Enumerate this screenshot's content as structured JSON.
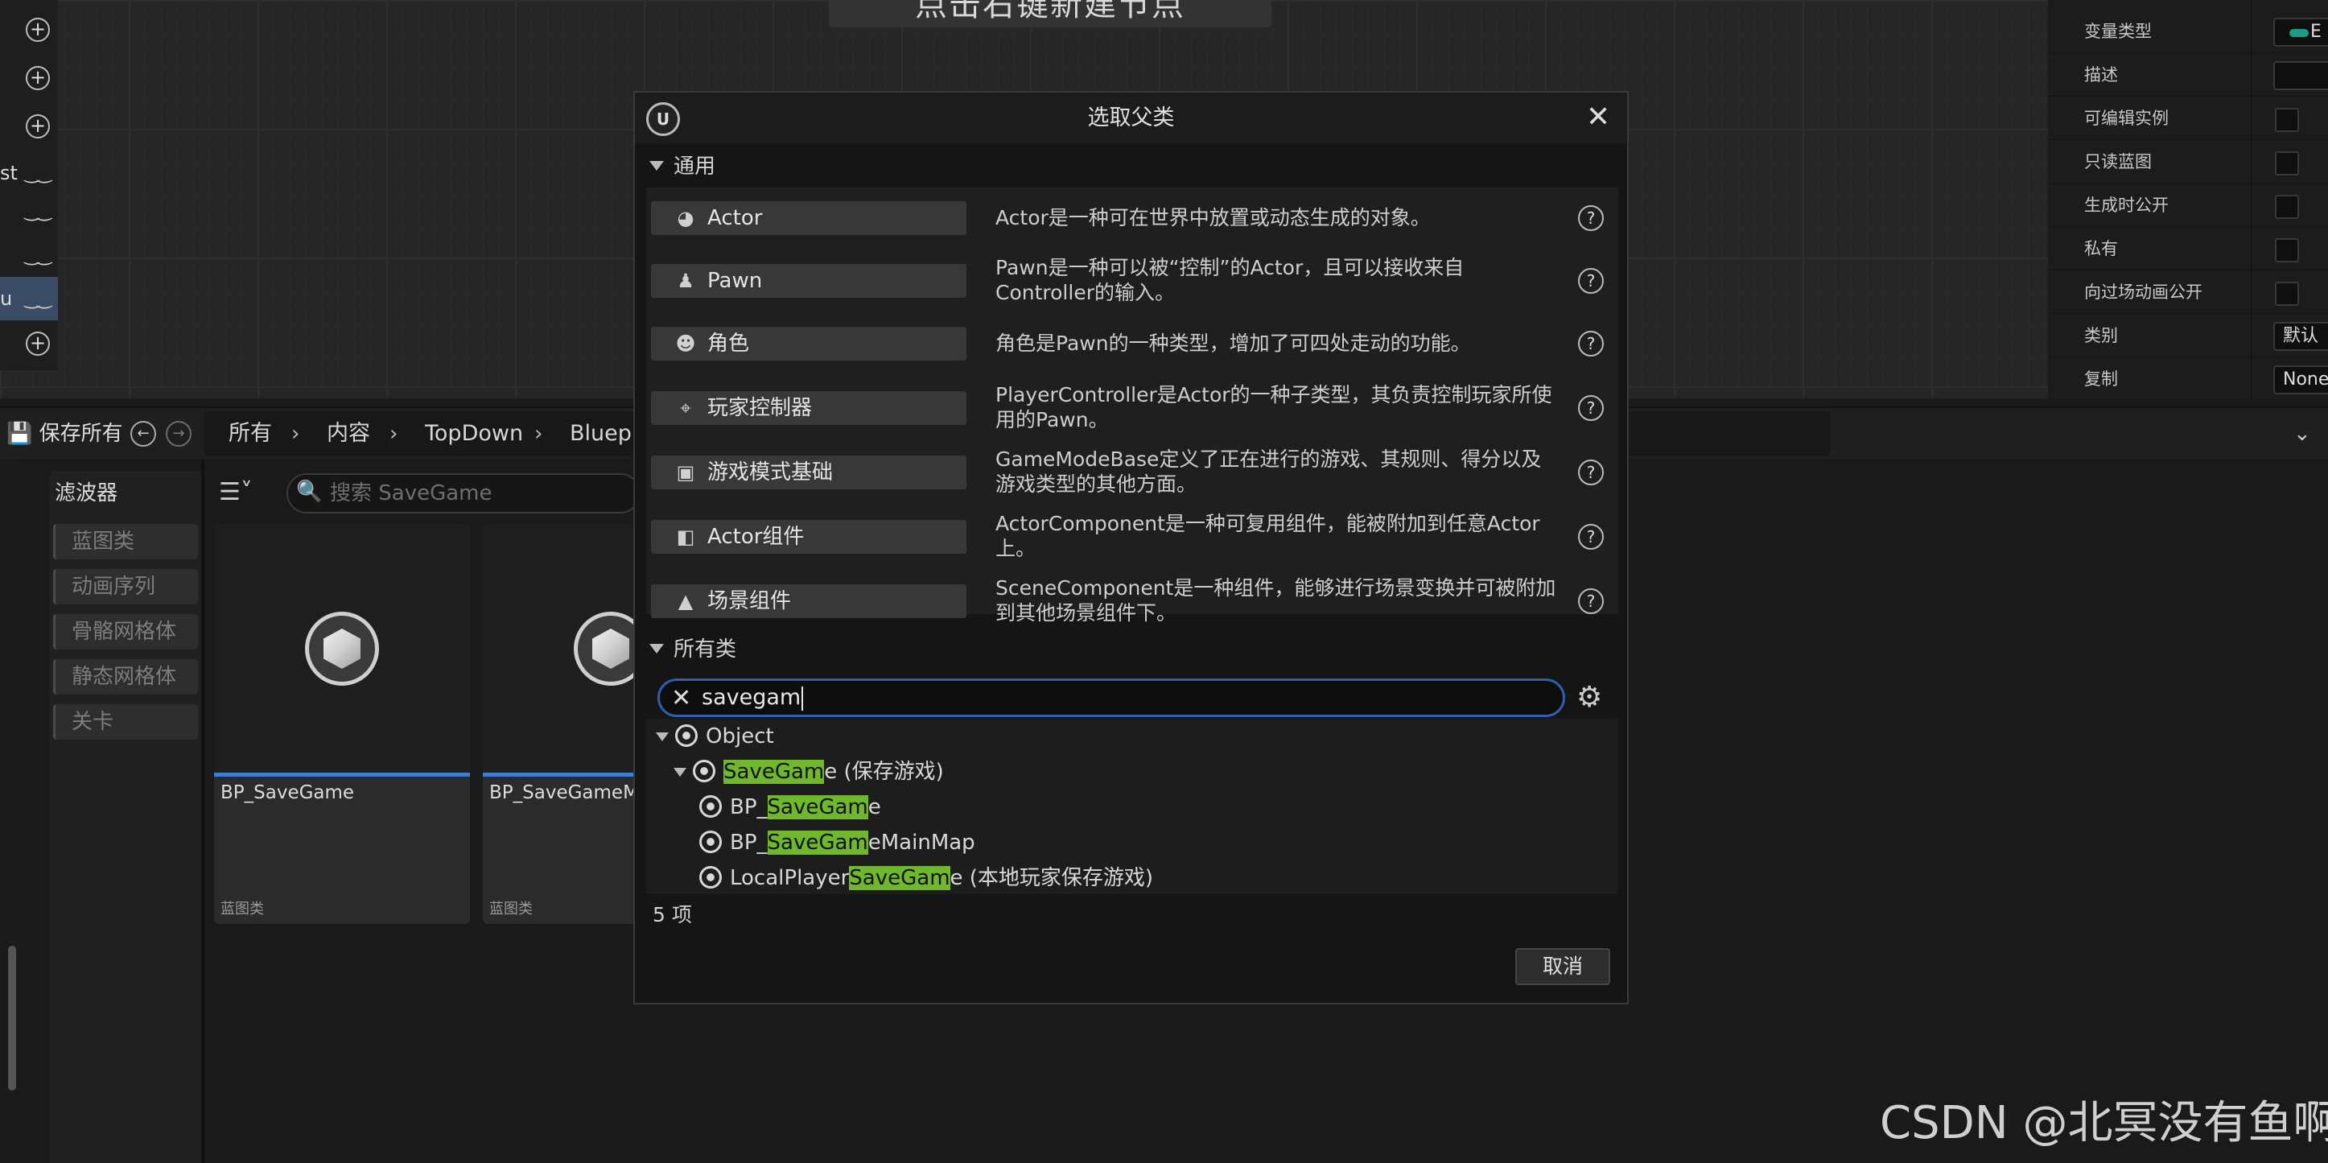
{
  "graph": {
    "hint": "点击右键新建节点"
  },
  "left_strip": {
    "rows": [
      {
        "type": "add"
      },
      {
        "type": "add"
      },
      {
        "type": "add"
      },
      {
        "type": "eye",
        "text": "st"
      },
      {
        "type": "eye",
        "text": ""
      },
      {
        "type": "eye",
        "text": ""
      },
      {
        "type": "eye",
        "text": "u",
        "selected": true
      },
      {
        "type": "add"
      }
    ]
  },
  "details": {
    "rows": [
      {
        "label": "变量类型",
        "kind": "pill",
        "value": "E"
      },
      {
        "label": "描述",
        "kind": "field",
        "value": ""
      },
      {
        "label": "可编辑实例",
        "kind": "check"
      },
      {
        "label": "只读蓝图",
        "kind": "check"
      },
      {
        "label": "生成时公开",
        "kind": "check"
      },
      {
        "label": "私有",
        "kind": "check"
      },
      {
        "label": "向过场动画公开",
        "kind": "check"
      },
      {
        "label": "类别",
        "kind": "field",
        "value": "默认"
      },
      {
        "label": "复制",
        "kind": "field",
        "value": "None"
      }
    ]
  },
  "content_browser": {
    "save_all": "保存所有",
    "breadcrumb": [
      "所有",
      "内容",
      "TopDown",
      "Bluepr"
    ],
    "filter_title": "滤波器",
    "filters": [
      "蓝图类",
      "动画序列",
      "骨骼网格体",
      "静态网格体",
      "关卡"
    ],
    "search_placeholder": "搜索 SaveGame",
    "assets": [
      {
        "name": "BP_SaveGame",
        "type": "蓝图类"
      },
      {
        "name": "BP_SaveGameM",
        "type": "蓝图类"
      }
    ]
  },
  "dialog": {
    "title": "选取父类",
    "logo": "U",
    "common_section": "通用",
    "common_classes": [
      {
        "label": "Actor",
        "icon": "actor-icon",
        "desc": "Actor是一种可在世界中放置或动态生成的对象。"
      },
      {
        "label": "Pawn",
        "icon": "pawn-icon",
        "desc": "Pawn是一种可以被“控制”的Actor，且可以接收来自Controller的输入。"
      },
      {
        "label": "角色",
        "icon": "character-icon",
        "desc": "角色是Pawn的一种类型，增加了可四处走动的功能。"
      },
      {
        "label": "玩家控制器",
        "icon": "gamepad-icon",
        "desc": "PlayerController是Actor的一种子类型，其负责控制玩家所使用的Pawn。"
      },
      {
        "label": "游戏模式基础",
        "icon": "game-mode-icon",
        "desc": "GameModeBase定义了正在进行的游戏、其规则、得分以及游戏类型的其他方面。"
      },
      {
        "label": "Actor组件",
        "icon": "component-icon",
        "desc": "ActorComponent是一种可复用组件，能被附加到任意Actor上。"
      },
      {
        "label": "场景组件",
        "icon": "scene-component-icon",
        "desc": "SceneComponent是一种组件，能够进行场景变换并可被附加到其他场景组件下。"
      }
    ],
    "all_section": "所有类",
    "search_value": "savegam",
    "tree": [
      {
        "level": 0,
        "expanded": true,
        "pre": "Object",
        "hl": "",
        "post": ""
      },
      {
        "level": 1,
        "expanded": true,
        "pre": "",
        "hl": "SaveGam",
        "post": "e (保存游戏)"
      },
      {
        "level": 2,
        "expanded": false,
        "pre": "BP_",
        "hl": "SaveGam",
        "post": "e"
      },
      {
        "level": 2,
        "expanded": false,
        "pre": "BP_",
        "hl": "SaveGam",
        "post": "eMainMap"
      },
      {
        "level": 2,
        "expanded": false,
        "pre": "LocalPlayer",
        "hl": "SaveGam",
        "post": "e (本地玩家保存游戏)"
      }
    ],
    "count": "5 项",
    "cancel": "取消"
  },
  "watermark": "CSDN @北冥没有鱼啊"
}
